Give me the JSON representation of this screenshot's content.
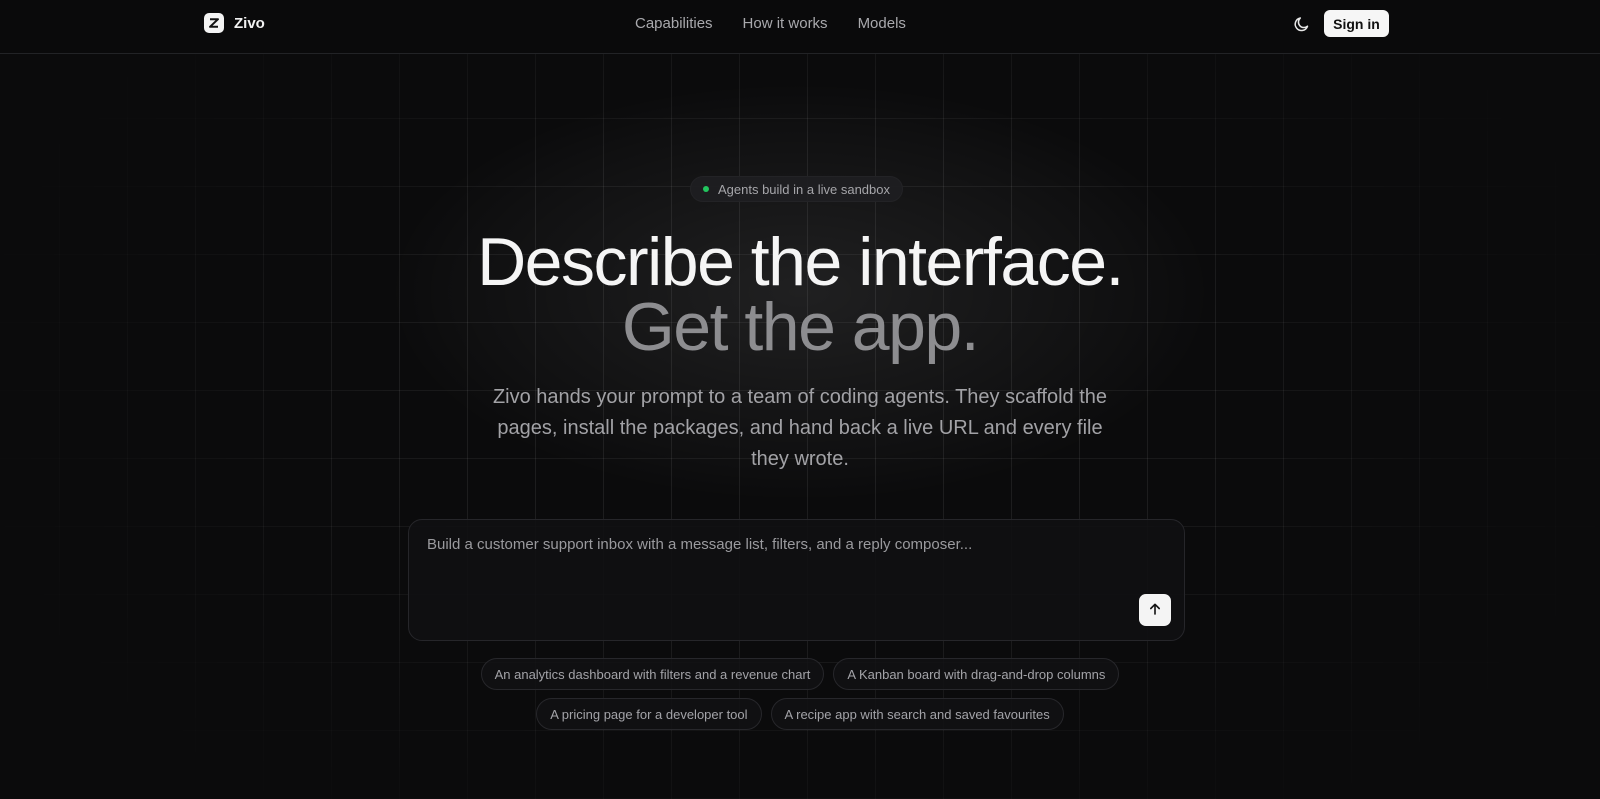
{
  "brand": {
    "name": "Zivo",
    "logo_icon": "z-logo-icon"
  },
  "nav": {
    "links": [
      "Capabilities",
      "How it works",
      "Models"
    ]
  },
  "header": {
    "theme_icon": "moon-icon",
    "signin_label": "Sign in"
  },
  "hero": {
    "badge": "Agents build in a live sandbox",
    "title_line1": "Describe the interface.",
    "title_line2": "Get the app.",
    "subtitle": "Zivo hands your prompt to a team of coding agents. They scaffold the pages, install the packages, and hand back a live URL and every file they wrote."
  },
  "prompt": {
    "placeholder": "Build a customer support inbox with a message list, filters, and a reply composer...",
    "value": "",
    "send_icon": "arrow-up-icon"
  },
  "suggestions": [
    "An analytics dashboard with filters and a revenue chart",
    "A Kanban board with drag-and-drop columns",
    "A pricing page for a developer tool",
    "A recipe app with search and saved favourites"
  ],
  "colors": {
    "status_dot": "#22c55e",
    "background": "#0b0b0c",
    "accent_button": "#f4f4f4"
  }
}
